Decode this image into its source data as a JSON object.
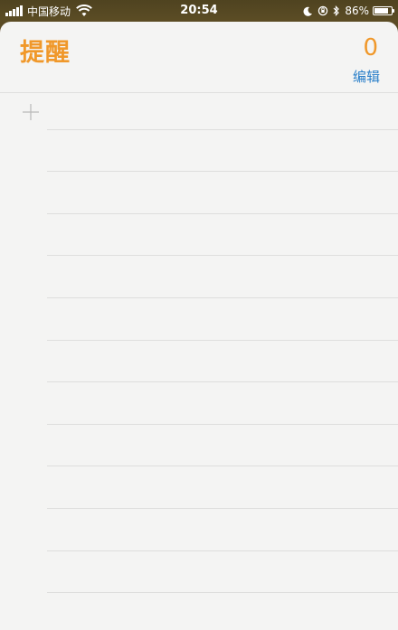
{
  "status_bar": {
    "carrier": "中国移动",
    "time": "20:54",
    "battery_percent": "86%",
    "battery_level": 0.86
  },
  "reminders": {
    "title": "提醒",
    "count": "0",
    "edit_label": "编辑",
    "add_icon": "plus-icon"
  },
  "colors": {
    "accent": "#f0982a",
    "link": "#2a7fc9",
    "background": "#f4f4f3",
    "status_bar": "#5a4a24"
  }
}
